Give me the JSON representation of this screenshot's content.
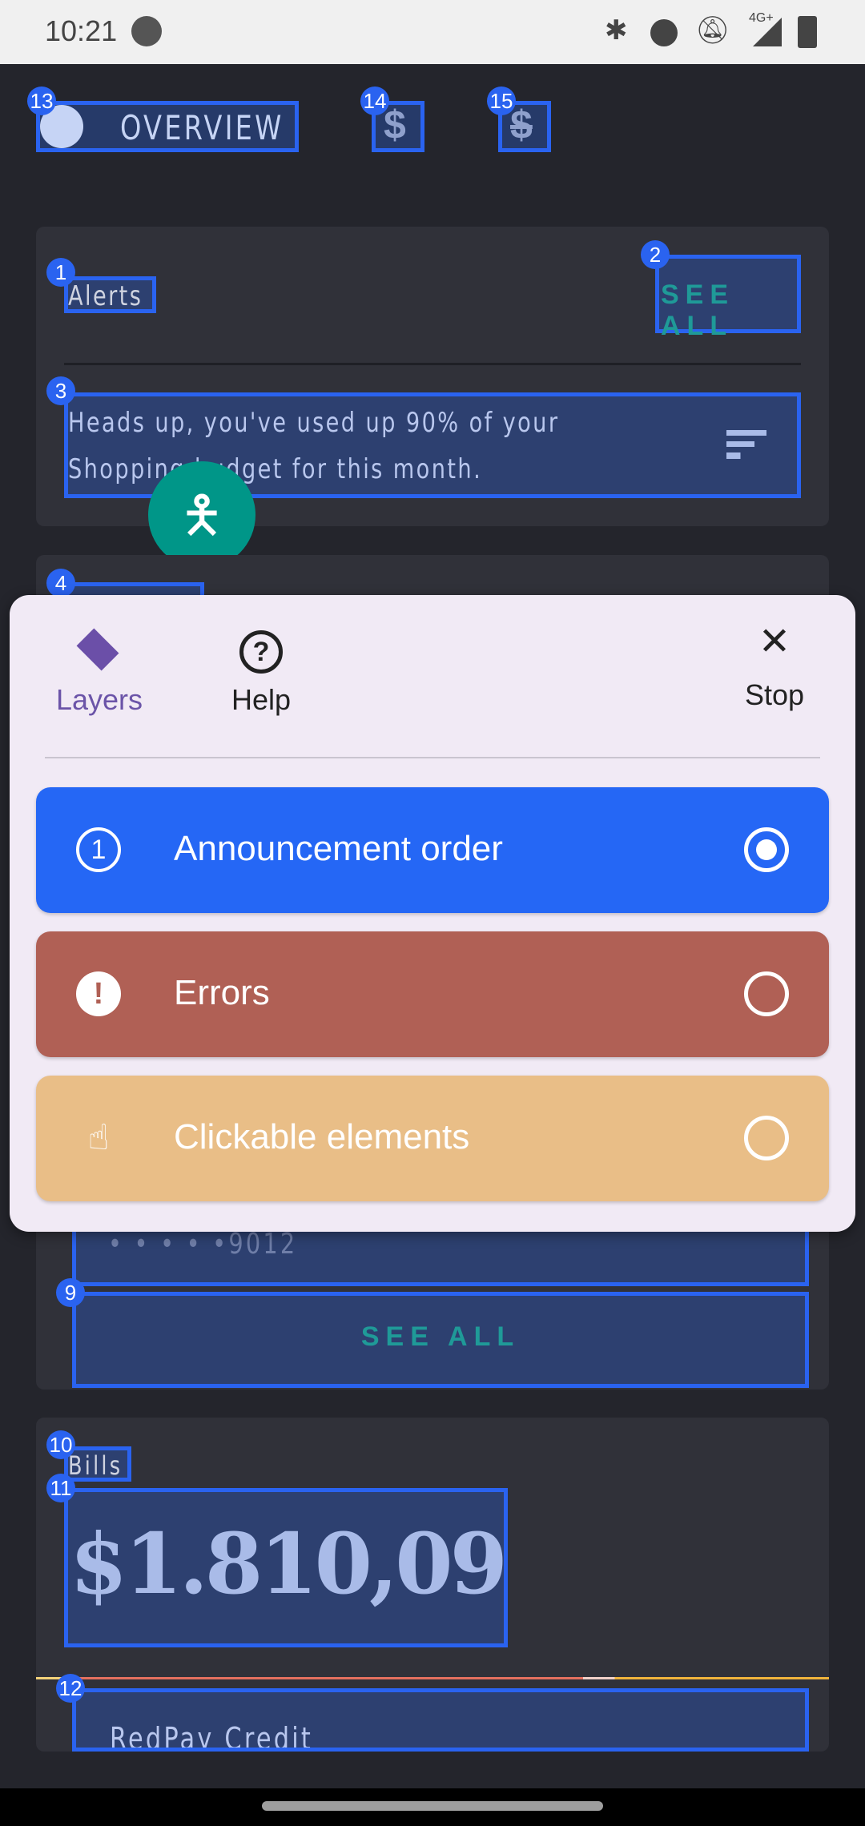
{
  "status_bar": {
    "time": "10:21",
    "icons": [
      "app-notification-icon",
      "bluetooth-icon",
      "do-not-disturb-icon",
      "notifications-off-icon",
      "signal-4g-icon",
      "battery-charging-icon"
    ],
    "network": "4G+"
  },
  "tabs": [
    {
      "label": "OVERVIEW",
      "icon": "pie-chart-icon",
      "badge": "13"
    },
    {
      "icon": "dollar-icon",
      "badge": "14"
    },
    {
      "icon": "dollar-off-icon",
      "badge": "15"
    }
  ],
  "alerts": {
    "title": "Alerts",
    "title_badge": "1",
    "see_all": "SEE ALL",
    "see_all_badge": "2",
    "message": "Heads up, you've used up 90% of your Shopping budget for this month.",
    "message_badge": "3"
  },
  "accounts": {
    "badge": "4",
    "account_mask": "• • • • •9012",
    "see_all": "SEE ALL",
    "see_all_badge": "9"
  },
  "bills": {
    "title": "Bills",
    "title_badge": "10",
    "amount": "$1.810,09",
    "amount_badge": "11",
    "first_item": "RedPay Credit",
    "first_item_badge": "12"
  },
  "overlay": {
    "tabs": [
      {
        "label": "Layers",
        "icon": "layers-icon"
      },
      {
        "label": "Help",
        "icon": "help-icon"
      },
      {
        "label": "Stop",
        "icon": "close-icon"
      }
    ],
    "options": [
      {
        "label": "Announcement order",
        "icon": "number-one-icon",
        "color": "#2567f5",
        "selected": true
      },
      {
        "label": "Errors",
        "icon": "error-icon",
        "color": "#b06055",
        "selected": false
      },
      {
        "label": "Clickable elements",
        "icon": "pointer-hand-icon",
        "color": "#e9be87",
        "selected": false
      }
    ]
  },
  "colors": {
    "accent_teal": "#1f9a98",
    "highlight": "#2a63f0",
    "background": "#24252c"
  }
}
